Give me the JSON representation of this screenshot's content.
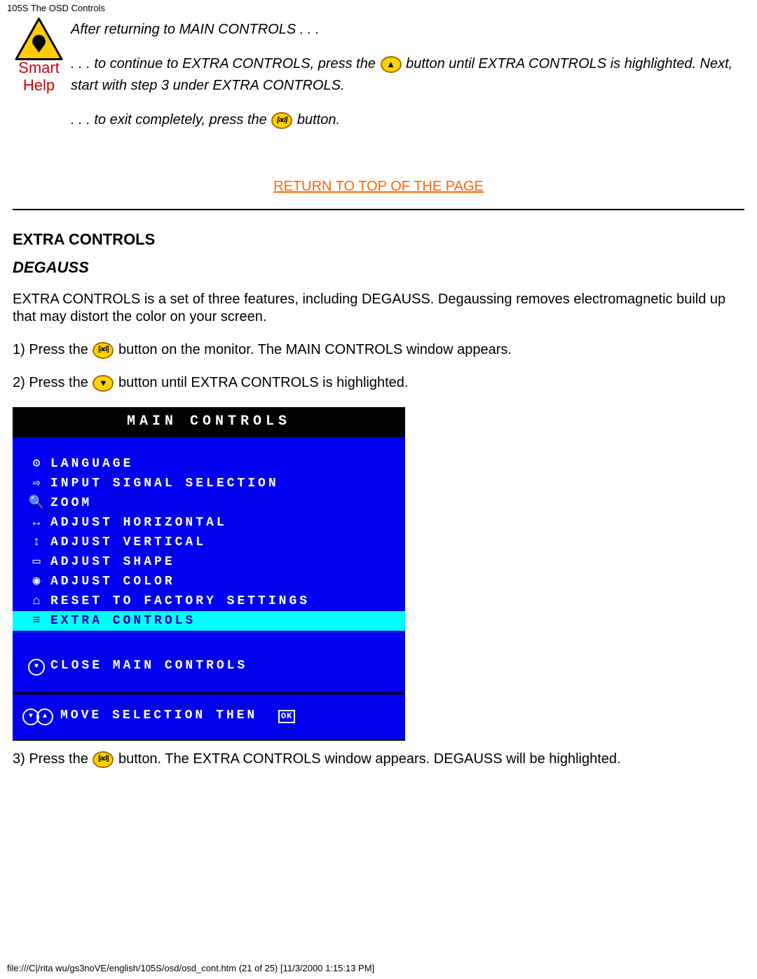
{
  "page_header": "105S The OSD Controls",
  "smart_help": {
    "label_line1": "Smart",
    "label_line2": "Help",
    "para1": "After returning to MAIN CONTROLS . . .",
    "para2a": ". . . to continue to EXTRA CONTROLS, press the ",
    "para2b": " button until EXTRA CONTROLS is highlighted. Next, start with step 3 under EXTRA CONTROLS.",
    "para3a": ". . . to exit completely, press the ",
    "para3b": " button."
  },
  "return_link": "RETURN TO TOP OF THE PAGE",
  "section_heading": "EXTRA CONTROLS",
  "section_sub": "DEGAUSS",
  "intro": "EXTRA CONTROLS is a set of three features, including DEGAUSS. Degaussing removes electromagnetic build up that may distort the color on your screen.",
  "step1a": "1) Press the ",
  "step1b": " button on the monitor. The MAIN CONTROLS window appears.",
  "step2a": "2) Press the ",
  "step2b": " button until EXTRA CONTROLS is highlighted.",
  "step3a": "3) Press the ",
  "step3b": " button. The EXTRA CONTROLS window appears. DEGAUSS will be highlighted.",
  "osd": {
    "title": "MAIN CONTROLS",
    "items": [
      {
        "icon": "⚙",
        "label": "LANGUAGE"
      },
      {
        "icon": "⇨",
        "label": "INPUT SIGNAL SELECTION"
      },
      {
        "icon": "🔍",
        "label": "ZOOM"
      },
      {
        "icon": "↔",
        "label": "ADJUST HORIZONTAL"
      },
      {
        "icon": "↕",
        "label": "ADJUST VERTICAL"
      },
      {
        "icon": "▭",
        "label": "ADJUST SHAPE"
      },
      {
        "icon": "◉",
        "label": "ADJUST COLOR"
      },
      {
        "icon": "⌂",
        "label": "RESET TO FACTORY SETTINGS"
      },
      {
        "icon": "≡",
        "label": "EXTRA CONTROLS",
        "highlight": true
      }
    ],
    "close_label": "CLOSE MAIN CONTROLS",
    "footer_label": "MOVE SELECTION THEN",
    "ok_symbol": "OK"
  },
  "page_footer": "file:///C|/rita wu/gs3noVE/english/105S/osd/osd_cont.htm (21 of 25) [11/3/2000 1:15:13 PM]"
}
